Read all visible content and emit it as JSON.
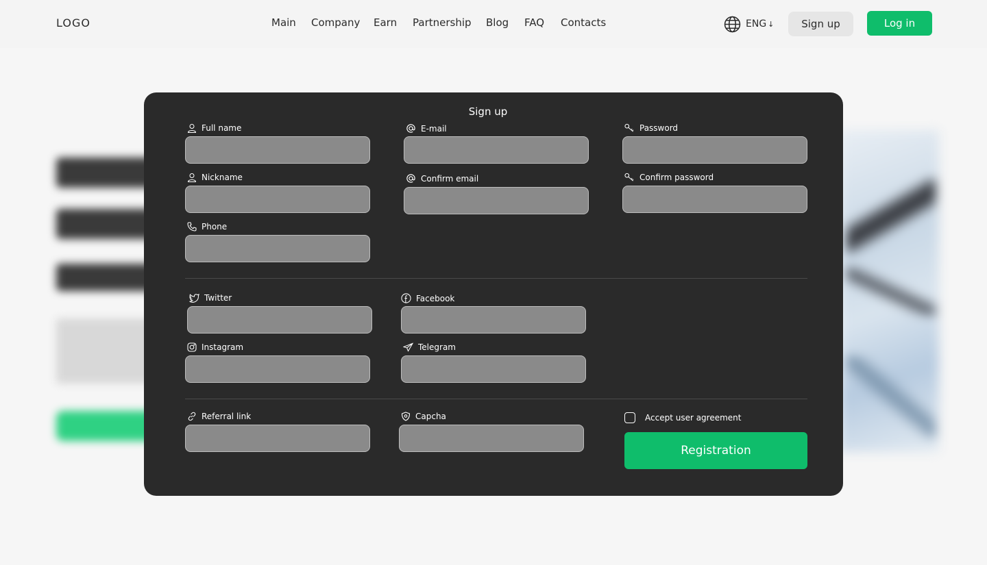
{
  "header": {
    "logo": "LOGO",
    "nav": [
      "Main",
      "Company",
      "Earn",
      "Partnership",
      "Blog",
      "FAQ",
      "Contacts"
    ],
    "language": "ENG",
    "language_arrow": "↓",
    "signup_label": "Sign up",
    "login_label": "Log in"
  },
  "form": {
    "title": "Sign up",
    "fields": {
      "full_name": "Full name",
      "email": "E-mail",
      "password": "Password",
      "nickname": "Nickname",
      "confirm_email": "Confirm email",
      "confirm_password": "Confirm password",
      "phone": "Phone",
      "twitter": "Twitter",
      "facebook": "Facebook",
      "instagram": "Instagram",
      "telegram": "Telegram",
      "referral": "Referral link",
      "capcha": "Capcha"
    },
    "agreement_label": "Accept user agreement",
    "agreement_checked": false,
    "register_label": "Registration"
  },
  "icons": {
    "language": "globe-icon",
    "full_name": "user-icon",
    "nickname": "user-icon",
    "email": "at-icon",
    "confirm_email": "at-icon",
    "password": "key-icon",
    "confirm_password": "key-icon",
    "phone": "phone-icon",
    "twitter": "twitter-icon",
    "facebook": "facebook-icon",
    "instagram": "instagram-icon",
    "telegram": "telegram-icon",
    "referral": "link-icon",
    "capcha": "shield-icon"
  },
  "colors": {
    "accent": "#0fbd6b",
    "modal_bg": "#2a2a2a",
    "input_bg": "#8a8a8a",
    "page_bg": "#f6f6f6"
  }
}
